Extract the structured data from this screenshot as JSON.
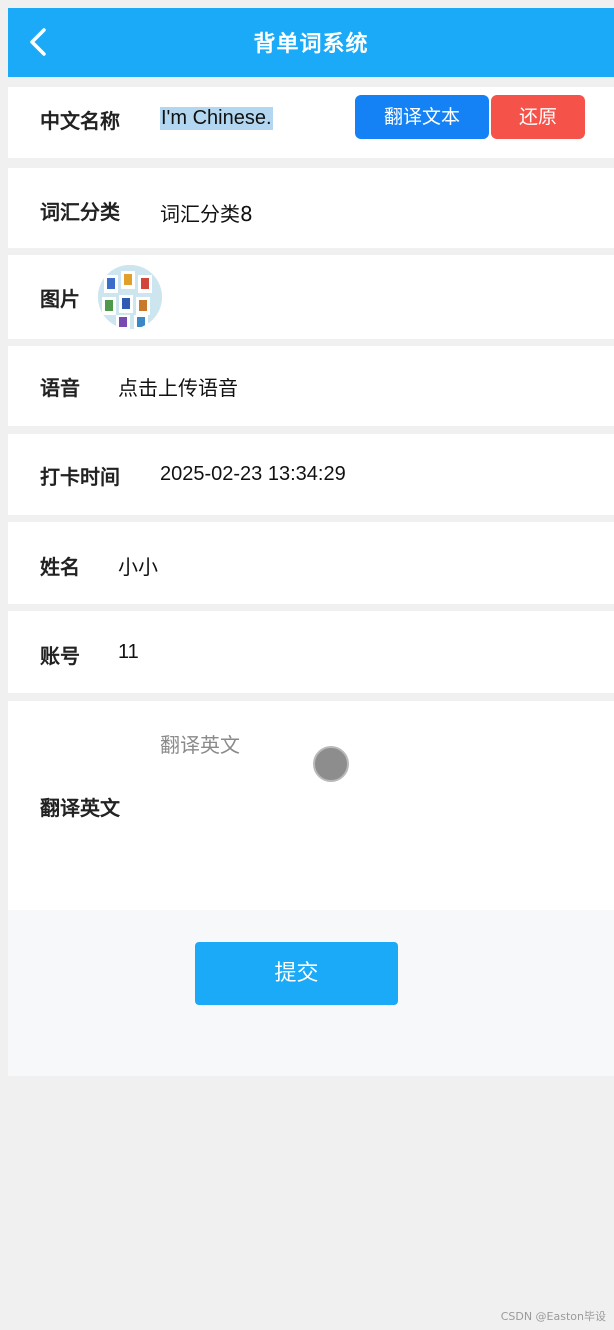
{
  "header": {
    "title": "背单词系统",
    "back_icon": "chevron-left-icon"
  },
  "form": {
    "name": {
      "label": "中文名称",
      "value": "I'm Chinese.",
      "translate_button": "翻译文本",
      "restore_button": "还原"
    },
    "category": {
      "label": "词汇分类",
      "value": "词汇分类8"
    },
    "image": {
      "label": "图片"
    },
    "audio": {
      "label": "语音",
      "value": "点击上传语音"
    },
    "checkin_time": {
      "label": "打卡时间",
      "value": "2025-02-23 13:34:29"
    },
    "user_name": {
      "label": "姓名",
      "value": "小小"
    },
    "account": {
      "label": "账号",
      "value": "11"
    },
    "translation": {
      "label": "翻译英文",
      "placeholder": "翻译英文",
      "value": ""
    }
  },
  "submit_label": "提交",
  "watermark": "CSDN @Easton毕设",
  "colors": {
    "header": "#1aaaf7",
    "translate_button": "#1482f5",
    "restore_button": "#f5524a",
    "submit_button": "#1aaaf7"
  }
}
